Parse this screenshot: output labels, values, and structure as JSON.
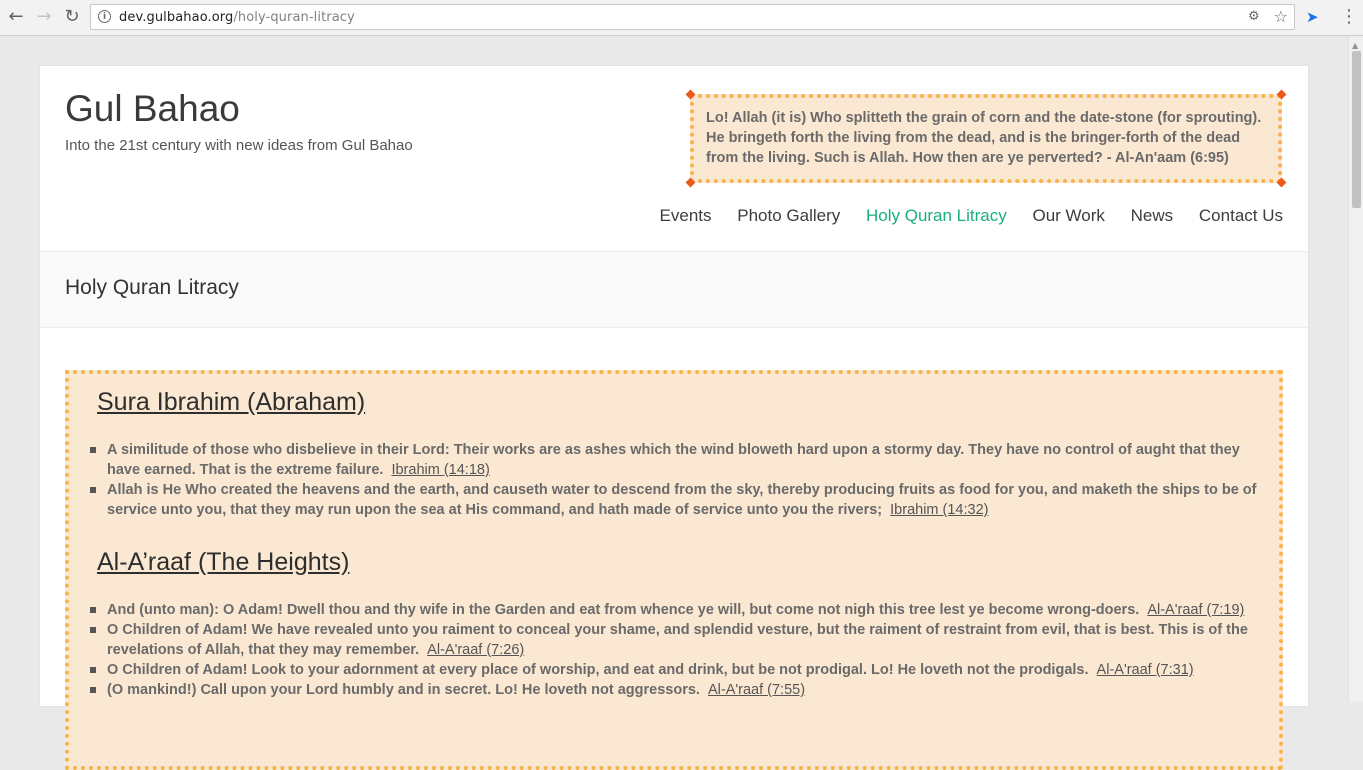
{
  "browser": {
    "url_domain": "dev.gulbahao.org",
    "url_path": "/holy-quran-litracy"
  },
  "site": {
    "title": "Gul Bahao",
    "tagline": "Into the 21st century with new ideas from Gul Bahao"
  },
  "header_quote": "Lo! Allah (it is) Who splitteth the grain of corn and the date-stone (for sprouting). He bringeth forth the living from the dead, and is the bringer-forth of the dead from the living. Such is Allah. How then are ye perverted? - Al-An'aam (6:95)",
  "nav": {
    "items": [
      {
        "label": "Events"
      },
      {
        "label": "Photo Gallery"
      },
      {
        "label": "Holy Quran Litracy"
      },
      {
        "label": "Our Work"
      },
      {
        "label": "News"
      },
      {
        "label": "Contact Us"
      }
    ],
    "active": "Holy Quran Litracy",
    "active_color": "#1bb07a"
  },
  "page_title": "Holy Quran Litracy",
  "suras": [
    {
      "heading": "Sura Ibrahim (Abraham)",
      "verses": [
        {
          "text": "A similitude of those who disbelieve in their Lord: Their works are as ashes which the wind bloweth hard upon a stormy day. They have no control of aught that they have earned. That is the extreme failure.",
          "ref": "Ibrahim (14:18)"
        },
        {
          "text": "Allah is He Who created the heavens and the earth, and causeth water to descend from the sky, thereby producing fruits as food for you, and maketh the ships to be of service unto you, that they may run upon the sea at His command, and hath made of service unto you the rivers;",
          "ref": "Ibrahim (14:32)"
        }
      ]
    },
    {
      "heading": "Al-A’raaf (The Heights)",
      "verses": [
        {
          "text": "And (unto man): O Adam! Dwell thou and thy wife in the Garden and eat from whence ye will, but come not nigh this tree lest ye become wrong-doers.",
          "ref": "Al-A'raaf (7:19)"
        },
        {
          "text": "O Children of Adam! We have revealed unto you raiment to conceal your shame, and splendid vesture, but the raiment of restraint from evil, that is best. This is of the revelations of Allah, that they may remember.",
          "ref": "Al-A'raaf (7:26)"
        },
        {
          "text": "O Children of Adam! Look to your adornment at every place of worship, and eat and drink, but be not prodigal. Lo! He loveth not the prodigals.",
          "ref": "Al-A'raaf (7:31)"
        },
        {
          "text": "(O mankind!) Call upon your Lord humbly and in secret. Lo! He loveth not aggressors.",
          "ref": "Al-A'raaf (7:55)"
        }
      ]
    }
  ]
}
